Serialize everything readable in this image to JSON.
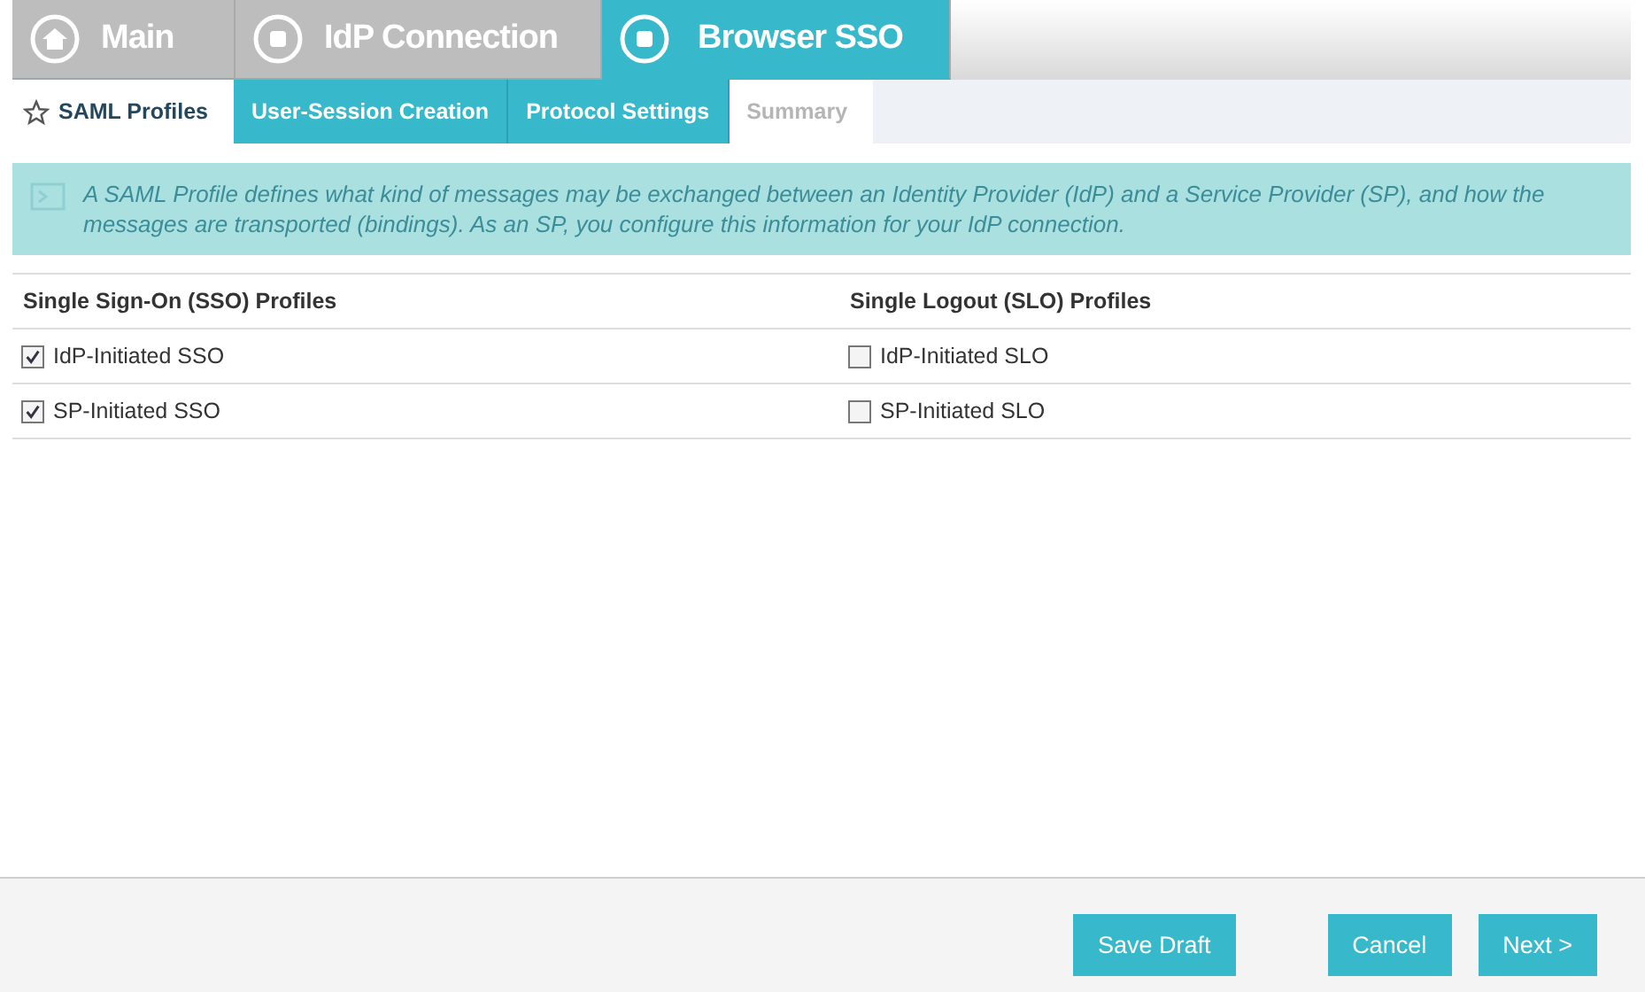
{
  "main_tabs": [
    {
      "label": "Main",
      "kind": "home",
      "selected": false
    },
    {
      "label": "IdP Connection",
      "kind": "step",
      "selected": false
    },
    {
      "label": "Browser SSO",
      "kind": "step",
      "selected": true
    }
  ],
  "sub_tabs": [
    {
      "label": "SAML Profiles",
      "kind": "current"
    },
    {
      "label": "User-Session Creation",
      "kind": "done"
    },
    {
      "label": "Protocol Settings",
      "kind": "done"
    },
    {
      "label": "Summary",
      "kind": "pending"
    }
  ],
  "info": "A SAML Profile defines what kind of messages may be exchanged between an Identity Provider (IdP) and a Service Provider (SP), and how the messages are transported (bindings). As an SP, you configure this information for your IdP connection.",
  "table": {
    "columns": [
      "Single Sign-On (SSO) Profiles",
      "Single Logout (SLO) Profiles"
    ],
    "rows": [
      [
        {
          "label": "IdP-Initiated SSO",
          "checked": true
        },
        {
          "label": "IdP-Initiated SLO",
          "checked": false
        }
      ],
      [
        {
          "label": "SP-Initiated SSO",
          "checked": true
        },
        {
          "label": "SP-Initiated SLO",
          "checked": false
        }
      ]
    ]
  },
  "footer": {
    "left_buttons": [
      "Save Draft"
    ],
    "right_buttons": [
      "Cancel",
      "Next >"
    ]
  }
}
